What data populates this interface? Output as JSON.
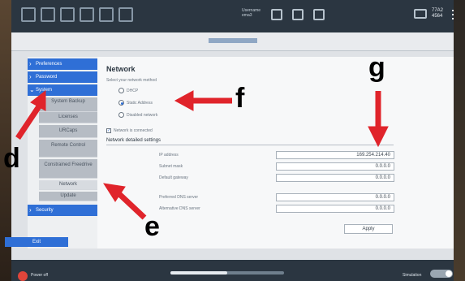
{
  "toolbar": {
    "mid_text_line1": "Username",
    "mid_text_line2": "ema3",
    "right_line1": "77A2",
    "right_line2": "4564"
  },
  "nav": {
    "items": [
      {
        "label": "Preferences"
      },
      {
        "label": "Password"
      },
      {
        "label": "System"
      },
      {
        "label": "Security"
      }
    ],
    "subitems": [
      {
        "label": "System Backup"
      },
      {
        "label": "Licenses"
      },
      {
        "label": "URCaps"
      },
      {
        "label": "Remote Control"
      },
      {
        "label": "Constrained Freedrive"
      },
      {
        "label": "Network"
      },
      {
        "label": "Update"
      }
    ],
    "exit_label": "Exit"
  },
  "network": {
    "title": "Network",
    "help": "Select your network method",
    "methods": [
      "DHCP",
      "Static Address",
      "Disabled network"
    ],
    "selected_method": "Static Address",
    "connected_label": "Network is connected",
    "details_title": "Network detailed settings",
    "fields": [
      {
        "label": "IP address",
        "value": "169.254.214.40"
      },
      {
        "label": "Subnet mask",
        "value": "0.0.0.0"
      },
      {
        "label": "Default gateway",
        "value": "0.0.0.0"
      },
      {
        "label": "Preferred DNS server",
        "value": "0.0.0.0"
      },
      {
        "label": "Alternative DNS server",
        "value": "0.0.0.0"
      }
    ],
    "apply_label": "Apply"
  },
  "bottom": {
    "power_label": "Power off",
    "mode_label": "Simulation"
  },
  "annotations": {
    "d": "d",
    "e": "e",
    "f": "f",
    "g": "g"
  },
  "colors": {
    "accent": "#2f6fd6",
    "toolbar": "#2b3641",
    "arrow_red": "#e0242b"
  }
}
